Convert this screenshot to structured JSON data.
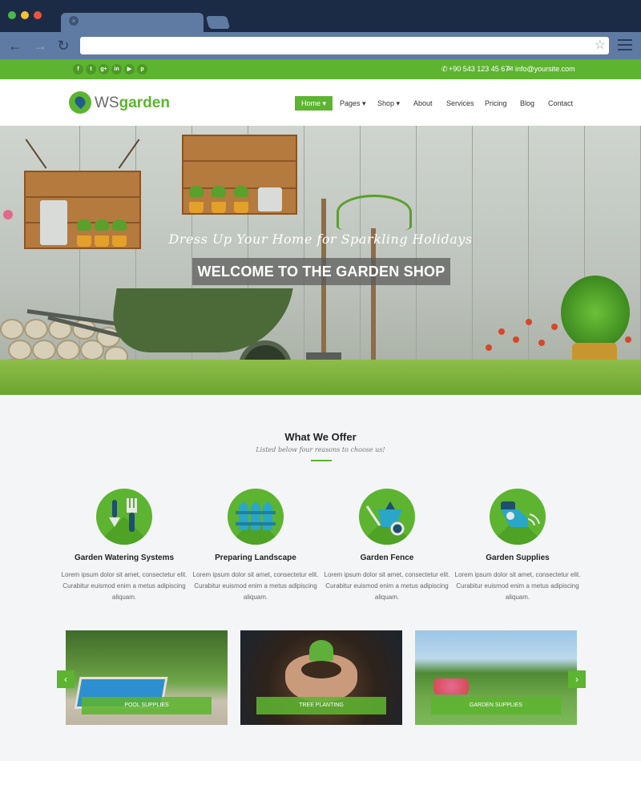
{
  "topbar": {
    "social": [
      {
        "icon": "facebook-icon",
        "glyph": "f"
      },
      {
        "icon": "twitter-icon",
        "glyph": "t"
      },
      {
        "icon": "google-plus-icon",
        "glyph": "g+"
      },
      {
        "icon": "linkedin-icon",
        "glyph": "in"
      },
      {
        "icon": "youtube-icon",
        "glyph": "▶"
      },
      {
        "icon": "pinterest-icon",
        "glyph": "p"
      }
    ],
    "phone": "+90 543 123 45 67",
    "email": "info@yoursite.com"
  },
  "header": {
    "logo_ws": "WS",
    "logo_garden": "garden",
    "nav": [
      "Home",
      "Pages",
      "Shop",
      "About",
      "Services",
      "Pricing",
      "Blog",
      "Contact"
    ],
    "active": "Home"
  },
  "hero": {
    "tagline": "Dress Up Your Home for Sparkling Holidays",
    "title": "WELCOME TO THE GARDEN SHOP"
  },
  "offer": {
    "title": "What We Offer",
    "subtitle": "Listed below four reasons to choose us!",
    "features": [
      {
        "icon": "garden-tools-icon",
        "title": "Garden Watering Systems",
        "text": "Lorem ipsum dolor sit amet, consectetur elit. Curabitur euismod enim a metus adipiscing aliquam."
      },
      {
        "icon": "fence-icon",
        "title": "Preparing Landscape",
        "text": "Lorem ipsum dolor sit amet, consectetur elit. Curabitur euismod enim a metus adipiscing aliquam."
      },
      {
        "icon": "wheelbarrow-icon",
        "title": "Garden Fence",
        "text": "Lorem ipsum dolor sit amet, consectetur elit. Curabitur euismod enim a metus adipiscing aliquam."
      },
      {
        "icon": "sprinkler-icon",
        "title": "Garden Supplies",
        "text": "Lorem ipsum dolor sit amet, consectetur elit. Curabitur euismod enim a metus adipiscing aliquam."
      }
    ]
  },
  "gallery": {
    "items": [
      "POOL SUPPLIES",
      "TREE PLANTING",
      "GARDEN SUPPLIES"
    ],
    "prev": "‹",
    "next": "›"
  },
  "colors": {
    "brand_green": "#5db430",
    "chrome_dark": "#1c2b45",
    "chrome_bar": "#5f7ba3"
  }
}
